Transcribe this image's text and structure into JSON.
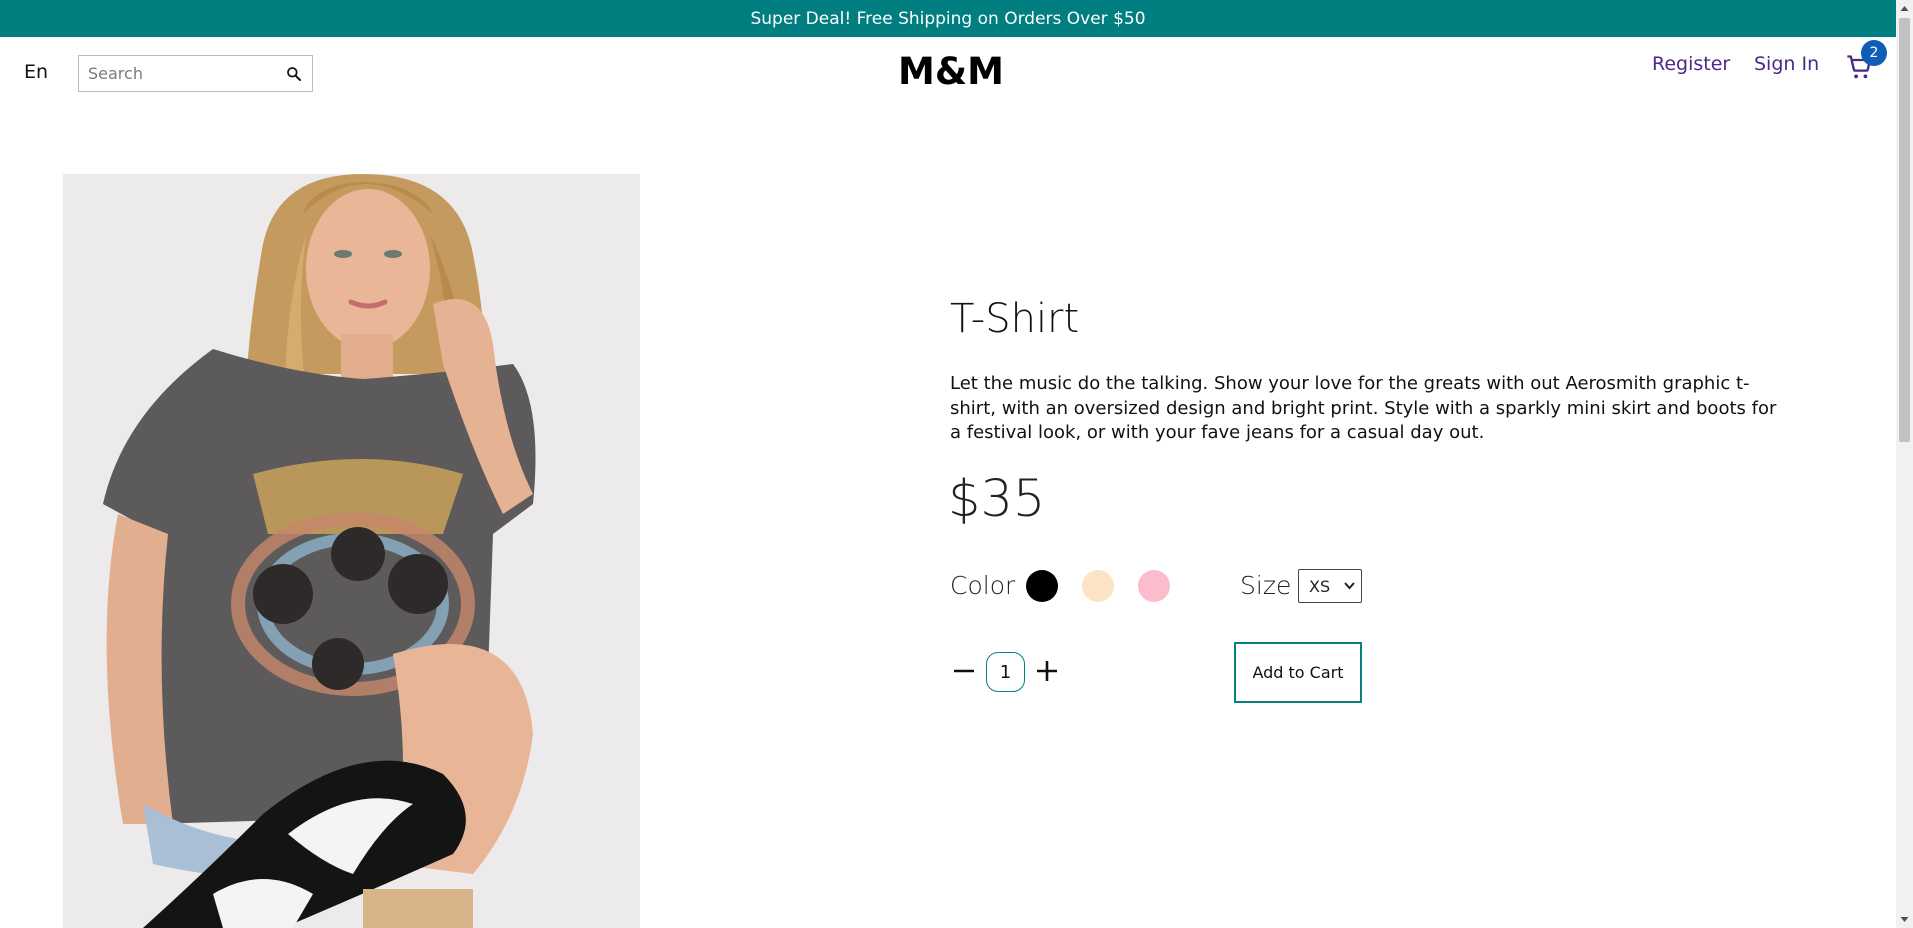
{
  "banner": {
    "text": "Super Deal! Free Shipping on Orders Over $50"
  },
  "header": {
    "language": "En",
    "search_placeholder": "Search",
    "logo": "M&M",
    "register": "Register",
    "sign_in": "Sign In",
    "cart_count": "2"
  },
  "product": {
    "title": "T-Shirt",
    "description": "Let the music do the talking. Show your love for the greats with out Aerosmith graphic t-shirt, with an oversized design and bright print. Style with a sparkly mini skirt and boots for a festival look, or with your fave jeans for a casual day out.",
    "price": "$35",
    "color_label": "Color",
    "colors": [
      "#000000",
      "#fde3c5",
      "#fbbccb"
    ],
    "size_label": "Size",
    "size_selected": "XS",
    "quantity": "1",
    "add_to_cart": "Add to Cart"
  },
  "theme": {
    "accent": "#007e80",
    "link": "#4a2a86",
    "badge": "#0f5db6"
  }
}
